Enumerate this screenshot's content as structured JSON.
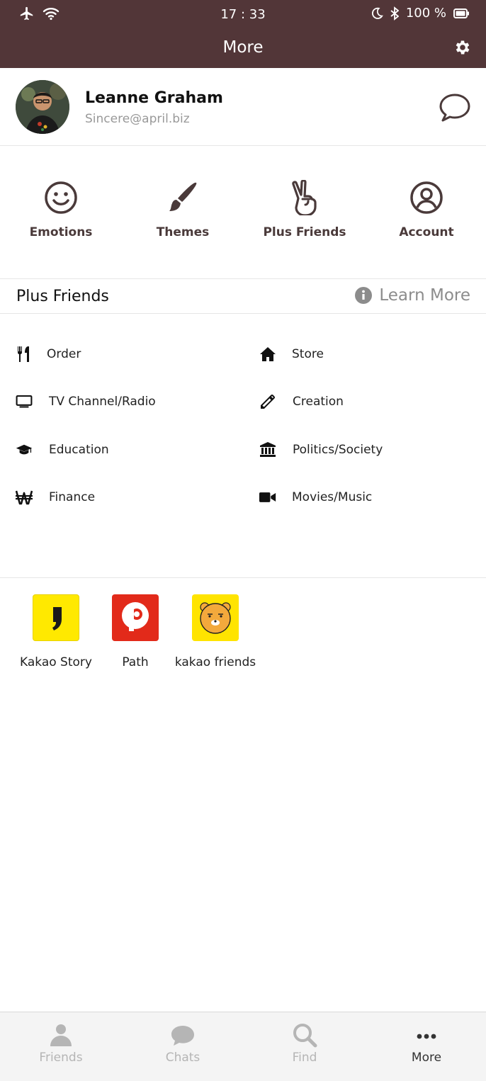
{
  "status_bar": {
    "time": "17 : 33",
    "battery": "100 %"
  },
  "header": {
    "title": "More"
  },
  "profile": {
    "name": "Leanne Graham",
    "email": "Sincere@april.biz"
  },
  "quick_menu": [
    {
      "label": "Emotions",
      "icon": "smile-icon"
    },
    {
      "label": "Themes",
      "icon": "paintbrush-icon"
    },
    {
      "label": "Plus Friends",
      "icon": "peace-hand-icon"
    },
    {
      "label": "Account",
      "icon": "user-circle-icon"
    }
  ],
  "plus_friends": {
    "title": "Plus Friends",
    "learn_more": "Learn More",
    "categories": [
      {
        "label": "Order",
        "icon": "utensils-icon"
      },
      {
        "label": "Store",
        "icon": "home-icon"
      },
      {
        "label": "TV Channel/Radio",
        "icon": "tv-icon"
      },
      {
        "label": "Creation",
        "icon": "pencil-icon"
      },
      {
        "label": "Education",
        "icon": "graduation-cap-icon"
      },
      {
        "label": "Politics/Society",
        "icon": "landmark-icon"
      },
      {
        "label": "Finance",
        "icon": "won-sign-icon"
      },
      {
        "label": "Movies/Music",
        "icon": "video-camera-icon"
      }
    ]
  },
  "apps": [
    {
      "label": "Kakao Story",
      "icon": "kakao-story-icon",
      "color": "#FFE900"
    },
    {
      "label": "Path",
      "icon": "path-icon",
      "color": "#E22A1A"
    },
    {
      "label": "kakao friends",
      "icon": "kakao-friends-icon",
      "color": "#FFE400"
    }
  ],
  "tabs": [
    {
      "label": "Friends",
      "icon": "person-icon",
      "active": false
    },
    {
      "label": "Chats",
      "icon": "chat-bubble-icon",
      "active": false
    },
    {
      "label": "Find",
      "icon": "search-icon",
      "active": false
    },
    {
      "label": "More",
      "icon": "more-dots-icon",
      "active": true
    }
  ],
  "colors": {
    "header_bg": "#523638",
    "accent_brown": "#4A3A3A",
    "inactive_tab": "#B5B5B5"
  }
}
